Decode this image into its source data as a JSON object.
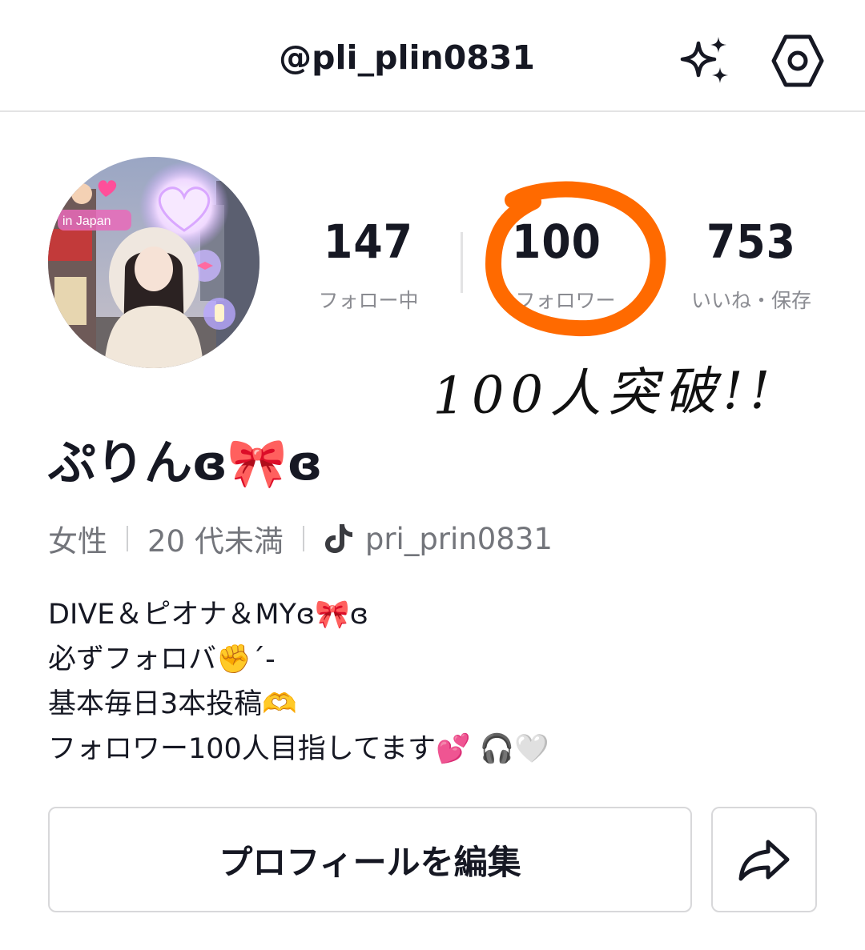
{
  "header": {
    "username": "@pli_plin0831",
    "sparkle_icon": "sparkle-icon",
    "settings_icon": "settings-icon"
  },
  "stats": [
    {
      "value": "147",
      "label": "フォロー中"
    },
    {
      "value": "100",
      "label": "フォロワー"
    },
    {
      "value": "753",
      "label": "いいね・保存"
    }
  ],
  "annotation": {
    "handwritten_note": "100人突破!!",
    "circle_color": "#ff6a00"
  },
  "profile": {
    "display_name": "ぷりんɞ🎀ɞ",
    "gender": "女性",
    "age": "20 代未満",
    "tiktok_handle": "pri_prin0831"
  },
  "bio": [
    "DIVE＆ピオナ＆MYɞ🎀ɞ",
    "必ずフォロバ✊´-",
    "基本毎日3本投稿🫶",
    "フォロワー100人目指してます💕 🎧🤍"
  ],
  "buttons": {
    "edit_profile": "プロフィールを編集",
    "share_icon": "share-arrow-icon"
  },
  "colors": {
    "text": "#161823",
    "secondary": "#8a8b91",
    "annotation": "#ff6a00"
  }
}
